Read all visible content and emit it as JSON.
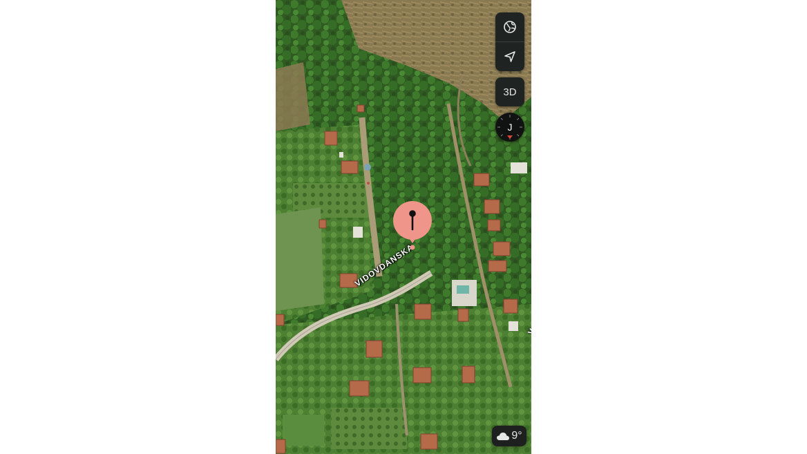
{
  "map": {
    "view": "satellite",
    "street_labels": [
      "VIDOVDANSKA",
      "V"
    ]
  },
  "controls": {
    "map_type_icon": "globe-icon",
    "locate_icon": "location-arrow-icon",
    "three_d_label": "3D",
    "compass_label": "J"
  },
  "weather": {
    "icon": "cloud-icon",
    "temperature": "9°"
  },
  "marker": {
    "icon": "pin-icon",
    "color": "#f0958a"
  }
}
